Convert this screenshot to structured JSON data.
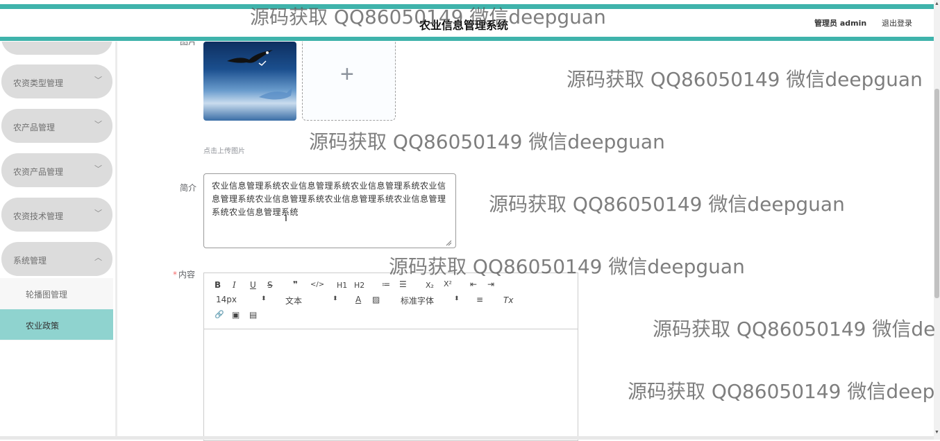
{
  "header": {
    "app_title": "农业信息管理系统",
    "user_label": "管理员 admin",
    "logout_label": "退出登录"
  },
  "sidebar": {
    "items": [
      {
        "label": "农资类型管理",
        "chevron": "﹀"
      },
      {
        "label": "农产品管理",
        "chevron": "﹀"
      },
      {
        "label": "农资产品管理",
        "chevron": "﹀"
      },
      {
        "label": "农资技术管理",
        "chevron": "﹀"
      },
      {
        "label": "系统管理",
        "chevron": "︿"
      }
    ],
    "sub_items": [
      {
        "label": "轮播图管理"
      },
      {
        "label": "农业政策"
      }
    ]
  },
  "form": {
    "image_label": "图片",
    "upload_plus": "+",
    "upload_hint": "点击上传图片",
    "summary_label": "简介",
    "summary_value": "农业信息管理系统农业信息管理系统农业信息管理系统农业信息管理系统农业信息管理系统农业信息管理系统农业信息管理系统农业信息管理系统",
    "content_required": "*",
    "content_label": "内容"
  },
  "editor": {
    "toolbar_row1": [
      "B",
      "I",
      "U",
      "S",
      "❞",
      "</>",
      "H1",
      "H2",
      "≔",
      "☰",
      "X₂",
      "X²",
      "⇤",
      "⇥"
    ],
    "font_size": "14px",
    "block_type": "文本",
    "font_family": "标准字体",
    "select_arrow": "⬍",
    "toolbar_row2_icons": [
      "A",
      "▨",
      "≡",
      "Tx"
    ],
    "toolbar_row3": [
      "🔗",
      "▣",
      "▤"
    ]
  },
  "watermarks": [
    "源码获取 QQ86050149 微信deepguan",
    "源码获取 QQ86050149 微信deepguan",
    "源码获取 QQ86050149 微信deepguan",
    "源码获取 QQ86050149 微信deepguan",
    "源码获取 QQ86050149 微信deepguan",
    "源码获取 QQ86050149 微信de",
    "源码获取 QQ86050149 微信deep"
  ],
  "colors": {
    "accent": "#3fb3ab",
    "active_submenu": "#8fd3cf",
    "menu_bg": "#dcdcdc",
    "required": "#f56c6c"
  }
}
